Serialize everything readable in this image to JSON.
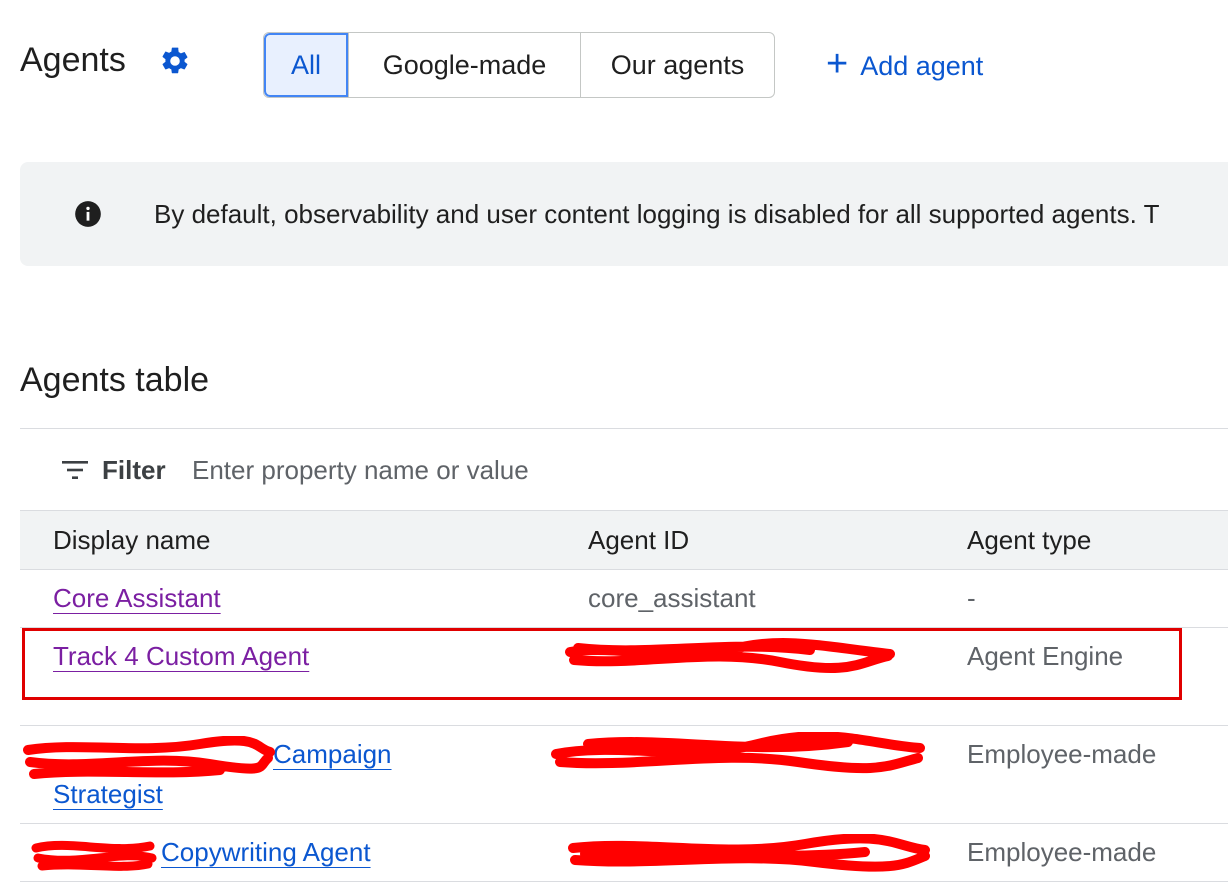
{
  "header": {
    "title": "Agents",
    "tabs": [
      {
        "label": "All",
        "active": true
      },
      {
        "label": "Google-made",
        "active": false
      },
      {
        "label": "Our agents",
        "active": false
      }
    ],
    "add_agent_label": "Add agent"
  },
  "banner": {
    "text": "By default, observability and user content logging is disabled for all supported agents. T"
  },
  "table": {
    "title": "Agents table",
    "filter_label": "Filter",
    "filter_placeholder": "Enter property name or value",
    "columns": [
      "Display name",
      "Agent ID",
      "Agent type"
    ],
    "rows": [
      {
        "name": "Core Assistant",
        "name_line2": "",
        "agent_id": "core_assistant",
        "agent_type": "-"
      },
      {
        "name": "Track 4 Custom Agent",
        "name_line2": "",
        "agent_id": "",
        "agent_type": "Agent Engine"
      },
      {
        "name": "Campaign",
        "name_line2": "Strategist",
        "agent_id": "",
        "agent_type": "Employee-made"
      },
      {
        "name": "Copywriting Agent",
        "name_line2": "",
        "agent_id": "",
        "agent_type": "Employee-made"
      }
    ]
  },
  "colors": {
    "primary": "#0b57d0",
    "visited_link": "#7b1fa2",
    "redaction": "#ff0000",
    "highlight": "#e00000"
  },
  "icons": {
    "settings": "gear-icon",
    "info": "info-icon",
    "filter": "filter-icon",
    "add": "plus-icon"
  }
}
